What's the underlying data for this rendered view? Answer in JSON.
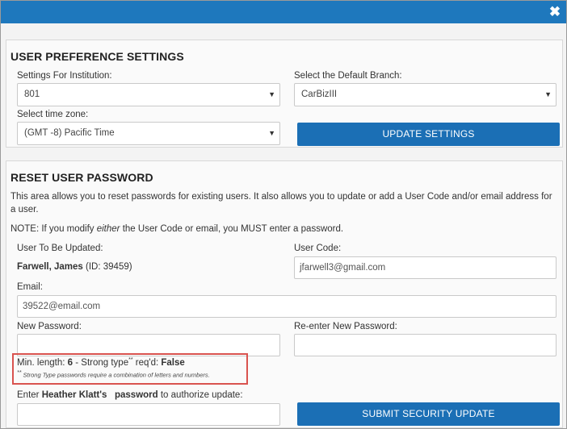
{
  "window": {
    "close_icon": "close-icon"
  },
  "prefs": {
    "title": "USER PREFERENCE SETTINGS",
    "institution_label": "Settings For Institution:",
    "institution_value": "801",
    "branch_label": "Select the Default Branch:",
    "branch_value": "CarBizIII",
    "timezone_label": "Select time zone:",
    "timezone_value": "(GMT -8) Pacific Time",
    "update_button": "UPDATE SETTINGS"
  },
  "reset": {
    "title": "RESET USER PASSWORD",
    "description": "This area allows you to reset passwords for existing users. It also allows you to update or add a User Code and/or email address for a user.",
    "note_prefix": "NOTE: If you modify ",
    "note_em": "either",
    "note_suffix": " the User Code or email, you MUST enter a password.",
    "user_label": "User To Be Updated:",
    "user_name": "Farwell, James",
    "user_id": "(ID: 39459)",
    "usercode_label": "User Code:",
    "usercode_value": "jfarwell3@gmail.com",
    "email_label": "Email:",
    "email_value": "39522@email.com",
    "newpw_label": "New Password:",
    "newpw_value": "",
    "reenter_label": "Re-enter New Password:",
    "reenter_value": "",
    "minlen_prefix": "Min. length: ",
    "minlen_value": "6",
    "strong_mid": " - Strong type",
    "strong_sup": "**",
    "reqd_text": " req'd: ",
    "reqd_value": "False",
    "strong_note_mark": "**",
    "strong_note": " Strong Type passwords require a combination of letters and numbers.",
    "authorize_prefix": "Enter ",
    "authorize_name": "Heather Klatt's",
    "authorize_mid": "   ",
    "authorize_bold": "password",
    "authorize_suffix": " to authorize update:",
    "authorize_value": "",
    "submit_button": "SUBMIT SECURITY UPDATE"
  }
}
